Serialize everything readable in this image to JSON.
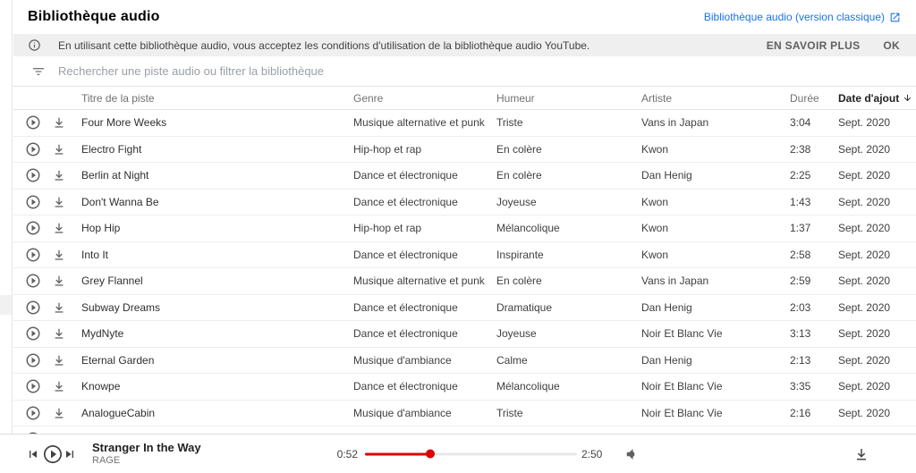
{
  "page": {
    "title": "Bibliothèque audio",
    "classic_link_label": "Bibliothèque audio (version classique)"
  },
  "notice": {
    "text": "En utilisant cette bibliothèque audio, vous acceptez les conditions d'utilisation de la bibliothèque audio YouTube.",
    "learn_more_label": "EN SAVOIR PLUS",
    "ok_label": "OK"
  },
  "search": {
    "placeholder": "Rechercher une piste audio ou filtrer la bibliothèque"
  },
  "table": {
    "headers": {
      "title": "Titre de la piste",
      "genre": "Genre",
      "mood": "Humeur",
      "artist": "Artiste",
      "duration": "Durée",
      "date_added": "Date d'ajout"
    },
    "sort": {
      "column": "date_added",
      "direction": "desc",
      "icon": "arrow-down"
    },
    "rows": [
      {
        "title": "Four More Weeks",
        "genre": "Musique alternative et punk",
        "mood": "Triste",
        "artist": "Vans in Japan",
        "duration": "3:04",
        "date": "Sept. 2020"
      },
      {
        "title": "Electro Fight",
        "genre": "Hip-hop et rap",
        "mood": "En colère",
        "artist": "Kwon",
        "duration": "2:38",
        "date": "Sept. 2020"
      },
      {
        "title": "Berlin at Night",
        "genre": "Dance et électronique",
        "mood": "En colère",
        "artist": "Dan Henig",
        "duration": "2:25",
        "date": "Sept. 2020"
      },
      {
        "title": "Don't Wanna Be",
        "genre": "Dance et électronique",
        "mood": "Joyeuse",
        "artist": "Kwon",
        "duration": "1:43",
        "date": "Sept. 2020"
      },
      {
        "title": "Hop Hip",
        "genre": "Hip-hop et rap",
        "mood": "Mélancolique",
        "artist": "Kwon",
        "duration": "1:37",
        "date": "Sept. 2020"
      },
      {
        "title": "Into It",
        "genre": "Dance et électronique",
        "mood": "Inspirante",
        "artist": "Kwon",
        "duration": "2:58",
        "date": "Sept. 2020"
      },
      {
        "title": "Grey Flannel",
        "genre": "Musique alternative et punk",
        "mood": "En colère",
        "artist": "Vans in Japan",
        "duration": "2:59",
        "date": "Sept. 2020"
      },
      {
        "title": "Subway Dreams",
        "genre": "Dance et électronique",
        "mood": "Dramatique",
        "artist": "Dan Henig",
        "duration": "2:03",
        "date": "Sept. 2020"
      },
      {
        "title": "MydNyte",
        "genre": "Dance et électronique",
        "mood": "Joyeuse",
        "artist": "Noir Et Blanc Vie",
        "duration": "3:13",
        "date": "Sept. 2020"
      },
      {
        "title": "Eternal Garden",
        "genre": "Musique d'ambiance",
        "mood": "Calme",
        "artist": "Dan Henig",
        "duration": "2:13",
        "date": "Sept. 2020"
      },
      {
        "title": "Knowpe",
        "genre": "Dance et électronique",
        "mood": "Mélancolique",
        "artist": "Noir Et Blanc Vie",
        "duration": "3:35",
        "date": "Sept. 2020"
      },
      {
        "title": "AnalogueCabin",
        "genre": "Musique d'ambiance",
        "mood": "Triste",
        "artist": "Noir Et Blanc Vie",
        "duration": "2:16",
        "date": "Sept. 2020"
      }
    ]
  },
  "player": {
    "track_title": "Stranger In the Way",
    "track_artist": "RAGE",
    "current_time": "0:52",
    "total_time": "2:50",
    "progress_percent": 31
  },
  "colors": {
    "accent_red": "#dd0000",
    "link_blue": "#1a73e8",
    "notice_bg": "#efefef"
  }
}
